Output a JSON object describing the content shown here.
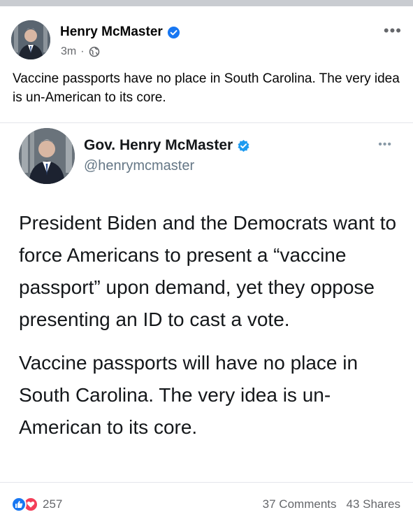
{
  "post": {
    "author": "Henry McMaster",
    "time": "3m",
    "separator": "·",
    "more": "•••",
    "text": "Vaccine passports have no place in South Carolina. The very idea is un-American to its core."
  },
  "tweet": {
    "author": "Gov. Henry McMaster",
    "handle": "@henrymcmaster",
    "more": "•••",
    "paragraphs": [
      "President Biden and the Democrats want to force Americans to present a “vaccine passport” upon demand, yet they oppose presenting an ID to cast a vote.",
      "Vaccine passports will have no place in South Carolina. The very idea is un-American to its core."
    ]
  },
  "footer": {
    "reaction_count": "257",
    "comments": "37 Comments",
    "shares": "43 Shares"
  },
  "colors": {
    "facebook_blue": "#1877f2",
    "love_red": "#f33e58",
    "verified_blue": "#1877f2",
    "muted_text": "#65676b"
  },
  "icons": {
    "verified": "verified-badge-icon",
    "privacy": "globe-icon",
    "like": "thumbs-up-icon",
    "love": "heart-icon"
  }
}
